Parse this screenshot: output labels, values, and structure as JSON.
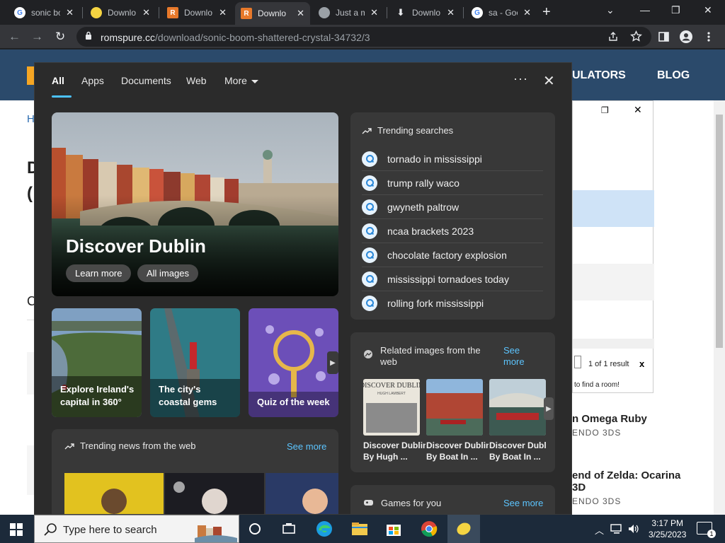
{
  "browser": {
    "tabs": [
      {
        "title": "sonic bo",
        "favicon": "google-icon",
        "color": "#4285f4",
        "active": false
      },
      {
        "title": "Downlo",
        "favicon": "lemon-icon",
        "color": "#f5d442",
        "active": false
      },
      {
        "title": "Downlo",
        "favicon": "romspure-r-icon",
        "color": "#e7792b",
        "active": false
      },
      {
        "title": "Downlo",
        "favicon": "romspure-r-icon",
        "color": "#e7792b",
        "active": true
      },
      {
        "title": "Just a m",
        "favicon": "globe-icon",
        "color": "#9aa0a6",
        "active": false
      },
      {
        "title": "Downlo",
        "favicon": "download-icon",
        "color": "#e8eaed",
        "active": false
      },
      {
        "title": "sa - Goo",
        "favicon": "google-icon",
        "color": "#4285f4",
        "active": false
      }
    ],
    "favicon_letters": {
      "google": "G",
      "romspure": "R"
    },
    "url_host": "romspure.cc",
    "url_path": "/download/sonic-boom-shattered-crystal-34732/3",
    "controls": {
      "back": "←",
      "forward": "→",
      "reload": "↻",
      "new_tab": "+",
      "minimize": "—",
      "maximize": "❐",
      "close": "✕",
      "tab_list": "⌄",
      "tab_close": "✕"
    }
  },
  "page": {
    "nav_emulators": "ULATORS",
    "nav_blog": "BLOG",
    "frag_h": "H",
    "frag_d": "D",
    "frag_paren": "(",
    "frag_c": "C",
    "dialog": {
      "count": "1 of 1 result",
      "close": "x",
      "hint": "to find a room!"
    },
    "games": [
      {
        "title": "n Omega Ruby",
        "sub": "ENDO 3DS"
      },
      {
        "title": "end of Zelda: Ocarina",
        "title2": "3D",
        "sub": "ENDO 3DS"
      }
    ]
  },
  "flyout": {
    "tabs": [
      "All",
      "Apps",
      "Documents",
      "Web",
      "More"
    ],
    "active_tab": "All",
    "more_dots": "···",
    "close": "✕",
    "hero": {
      "title": "Discover Dublin",
      "learn_more": "Learn more",
      "all_images": "All images"
    },
    "cards": [
      {
        "caption": "Explore Ireland's capital in 360°"
      },
      {
        "caption": "The city's coastal gems"
      },
      {
        "caption": "Quiz of the week"
      }
    ],
    "trending_news": {
      "title": "Trending news from the web",
      "see_more": "See more"
    },
    "trending_searches": {
      "title": "Trending searches",
      "items": [
        "tornado in mississippi",
        "trump rally waco",
        "gwyneth paltrow",
        "ncaa brackets 2023",
        "chocolate factory explosion",
        "mississippi tornadoes today",
        "rolling fork mississippi"
      ]
    },
    "related_images": {
      "title": "Related images from the web",
      "see_more": "See more",
      "items": [
        {
          "caption1": "Discover Dublin",
          "caption2": "By Hugh ...",
          "book_title": "DISCOVER DUBLIN",
          "book_author": "HUGH LAMBERT"
        },
        {
          "caption1": "Discover Dublin",
          "caption2": "By Boat In ..."
        },
        {
          "caption1": "Discover Dublin",
          "caption2": "By Boat In ..."
        }
      ]
    },
    "games_for_you": {
      "title": "Games for you",
      "see_more": "See more"
    },
    "accent": "#5cc5ff"
  },
  "taskbar": {
    "search_placeholder": "Type here to search",
    "time": "3:17 PM",
    "date": "3/25/2023",
    "notification_count": "1"
  }
}
